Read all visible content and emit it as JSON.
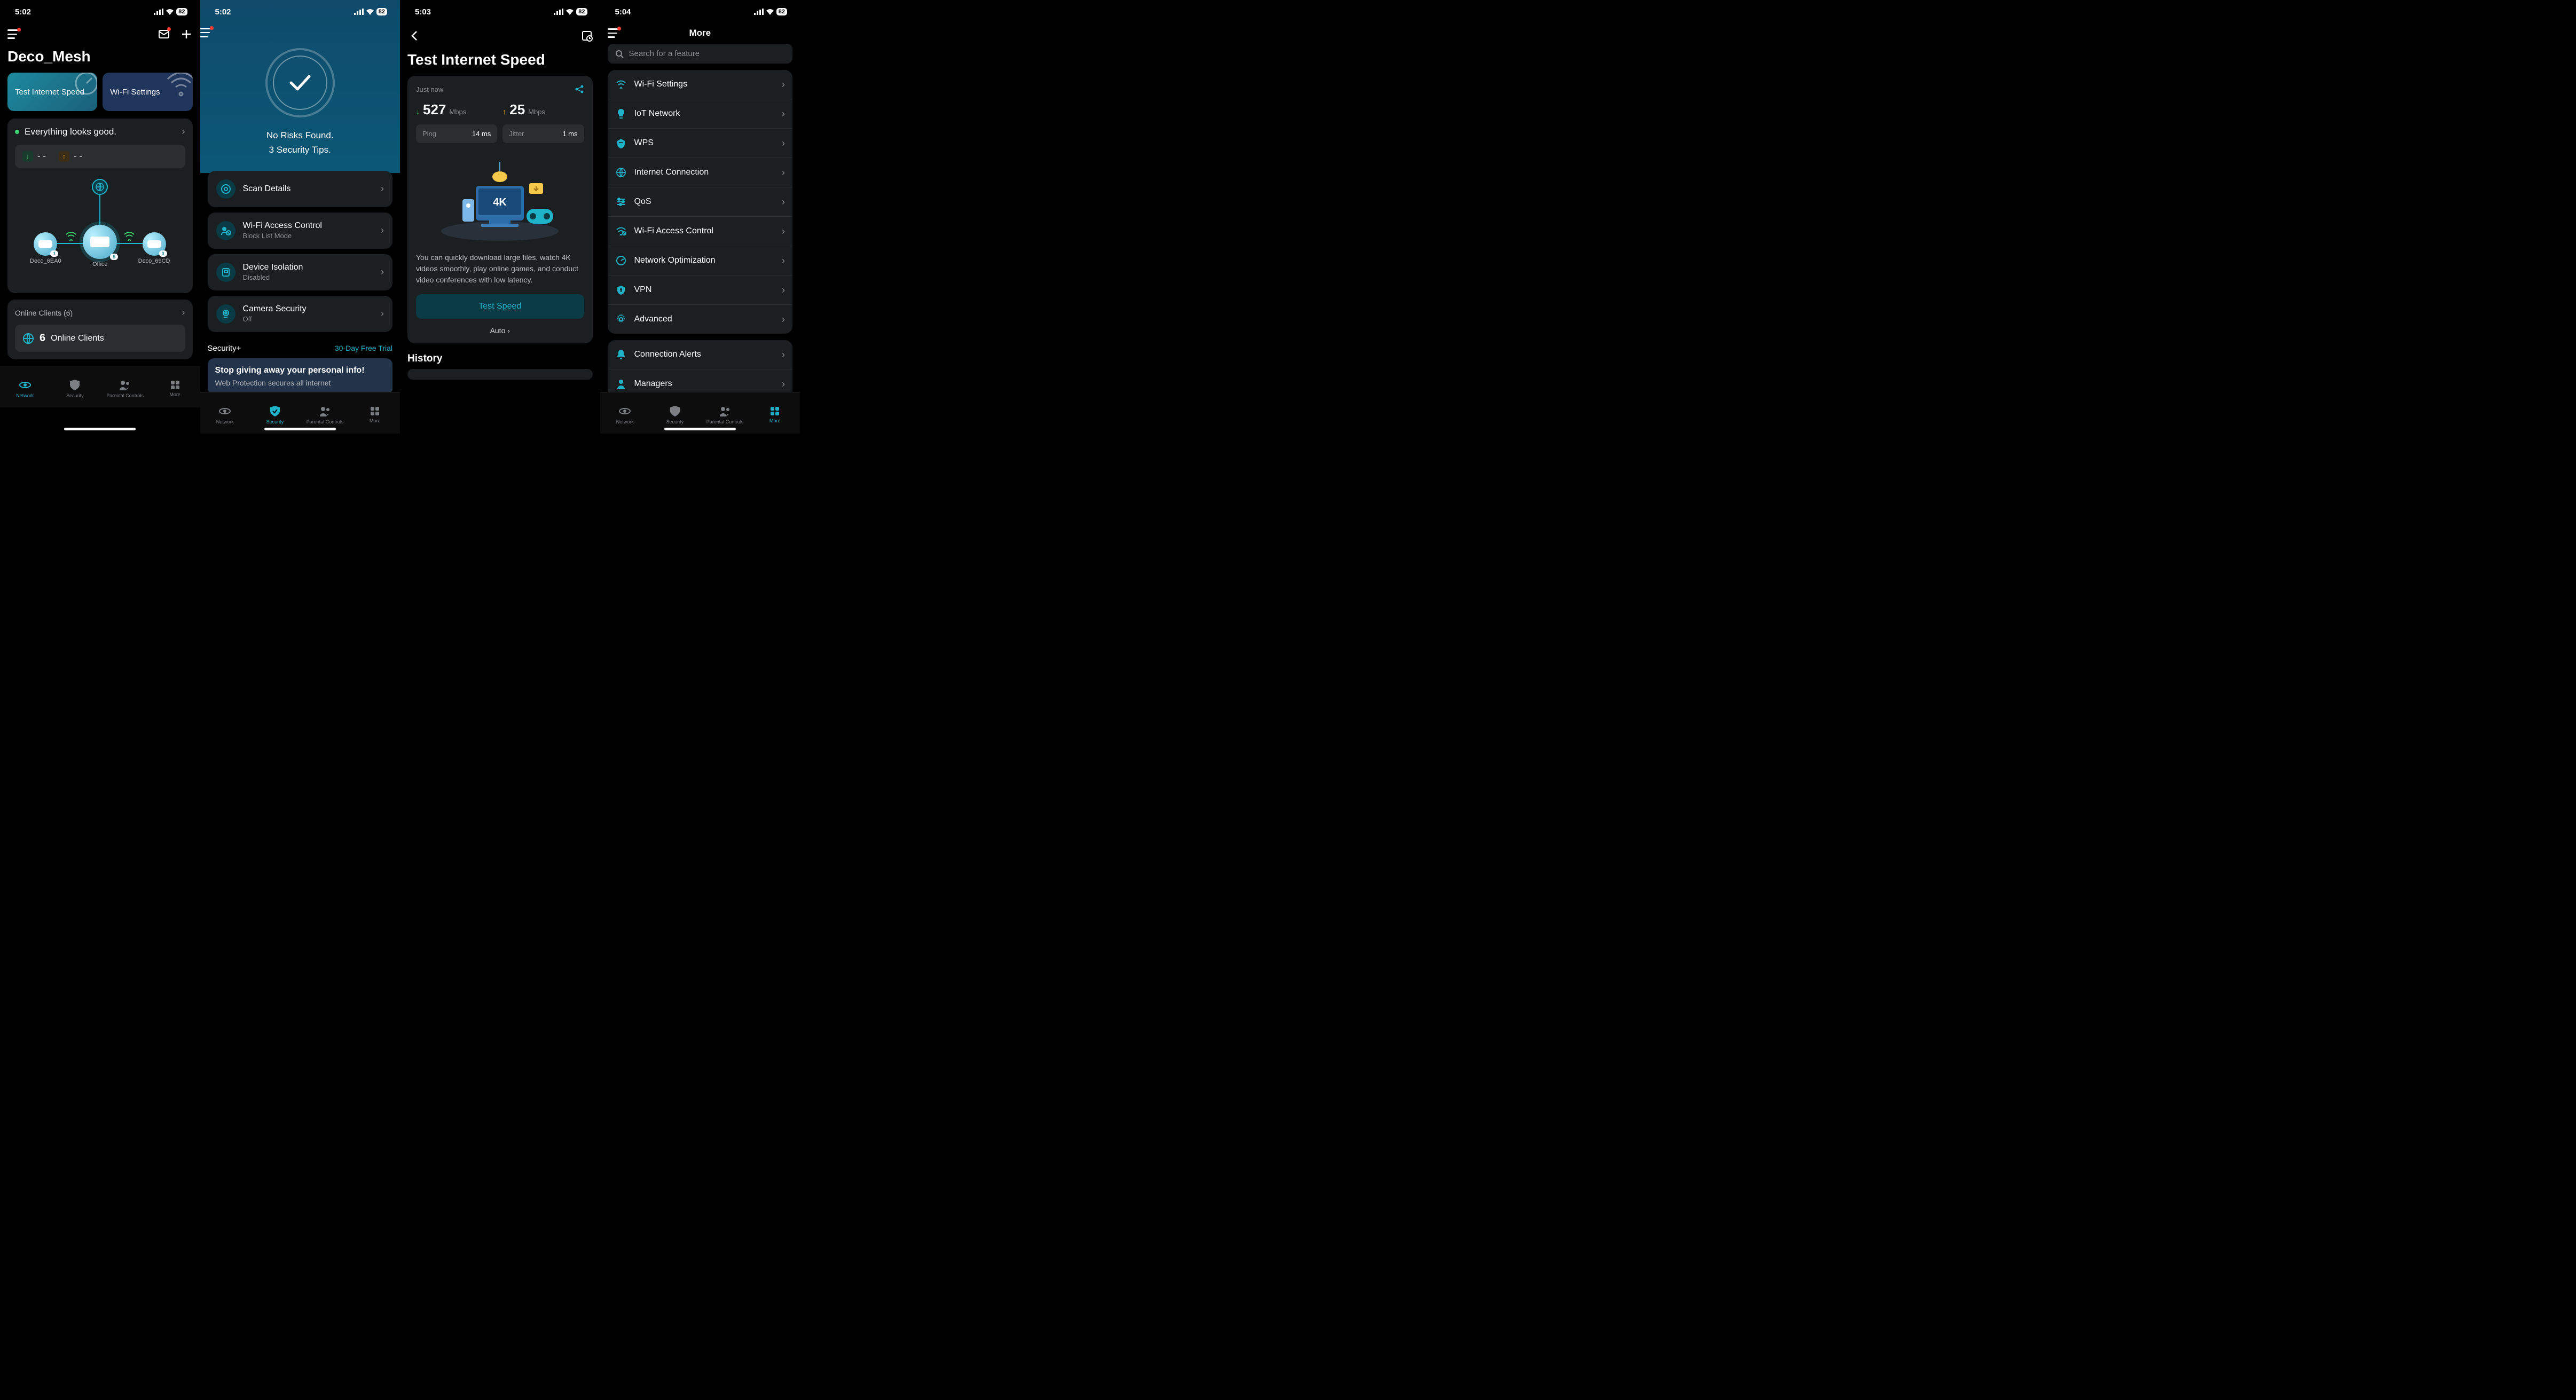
{
  "status_bar": {
    "s1_time": "5:02",
    "s2_time": "5:02",
    "s3_time": "5:03",
    "s4_time": "5:04",
    "battery": "82"
  },
  "screen1": {
    "title": "Deco_Mesh",
    "action_speed": "Test Internet Speed",
    "action_wifi": "Wi-Fi Settings",
    "status_text": "Everything looks good.",
    "down_placeholder": "- -",
    "up_placeholder": "- -",
    "nodes": {
      "left": {
        "label": "Deco_6EA0",
        "badge": "1"
      },
      "center": {
        "label": "Office",
        "badge": "5"
      },
      "right": {
        "label": "Deco_69CD",
        "badge": "0"
      }
    },
    "online_header": "Online Clients (6)",
    "online_count": "6",
    "online_label": "Online Clients"
  },
  "screen2": {
    "status_line1": "No Risks Found.",
    "status_line2": "3 Security Tips.",
    "items": [
      {
        "title": "Scan Details",
        "sub": ""
      },
      {
        "title": "Wi-Fi Access Control",
        "sub": "Block List Mode"
      },
      {
        "title": "Device Isolation",
        "sub": "Disabled"
      },
      {
        "title": "Camera Security",
        "sub": "Off"
      }
    ],
    "plus_title": "Security+",
    "trial": "30-Day Free Trial",
    "promo_title": "Stop giving away your personal info!",
    "promo_text": "Web Protection secures all internet"
  },
  "screen3": {
    "title": "Test Internet Speed",
    "timestamp": "Just now",
    "down_value": "527",
    "down_unit": "Mbps",
    "up_value": "25",
    "up_unit": "Mbps",
    "ping_label": "Ping",
    "ping_value": "14 ms",
    "jitter_label": "Jitter",
    "jitter_value": "1 ms",
    "illustration_badge": "4K",
    "description": "You can quickly download large files, watch 4K videos smoothly, play online games, and conduct video conferences with low latency.",
    "test_button": "Test Speed",
    "auto_label": "Auto",
    "history_title": "History"
  },
  "screen4": {
    "title": "More",
    "search_placeholder": "Search for a feature",
    "group1": [
      "Wi-Fi Settings",
      "IoT Network",
      "WPS",
      "Internet Connection",
      "QoS",
      "Wi-Fi Access Control",
      "Network Optimization",
      "VPN",
      "Advanced"
    ],
    "group2": [
      "Connection Alerts",
      "Managers"
    ]
  },
  "tabs": {
    "network": "Network",
    "security": "Security",
    "parental": "Parental Controls",
    "more": "More"
  }
}
